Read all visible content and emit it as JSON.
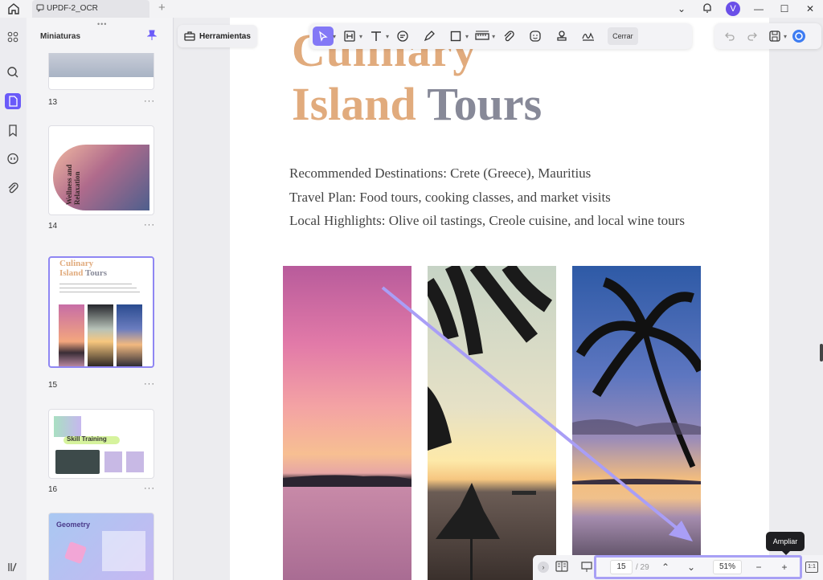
{
  "titlebar": {
    "tab_title": "UPDF-2_OCR",
    "new_tab": "+",
    "avatar_initial": "V"
  },
  "panel": {
    "title": "Miniaturas",
    "thumbnails": [
      {
        "page": "13",
        "dots": "···"
      },
      {
        "page": "14",
        "dots": "···",
        "vertical_text": "Wellness and Relaxation"
      },
      {
        "page": "15",
        "dots": "···",
        "mini_title1": "Culinary",
        "mini_title2a": "Island",
        "mini_title2b": "Tours"
      },
      {
        "page": "16",
        "dots": "···",
        "mini_title": "Skill Training"
      },
      {
        "page": "17",
        "mini_title": "Geometry"
      }
    ]
  },
  "toolbar": {
    "tools_label": "Herramientas",
    "close_label": "Cerrar"
  },
  "document": {
    "title_line1": "Culinary",
    "title_line2a": "Island",
    "title_line2b": "Tours",
    "lines": [
      "Recommended Destinations: Crete (Greece), Mauritius",
      "Travel Plan: Food tours, cooking classes, and market visits",
      "Local Highlights: Olive oil tastings, Creole cuisine, and local wine tours"
    ]
  },
  "pager": {
    "current_page": "15",
    "total": "/ 29",
    "zoom": "51%",
    "zoom_out": "−",
    "zoom_in": "+",
    "fit": "1:1"
  },
  "tooltip": "Ampliar",
  "colors": {
    "accent": "#6a5af9",
    "title_orange": "#e1ab7d",
    "title_gray": "#878998",
    "highlight": "#a8a0f5"
  }
}
